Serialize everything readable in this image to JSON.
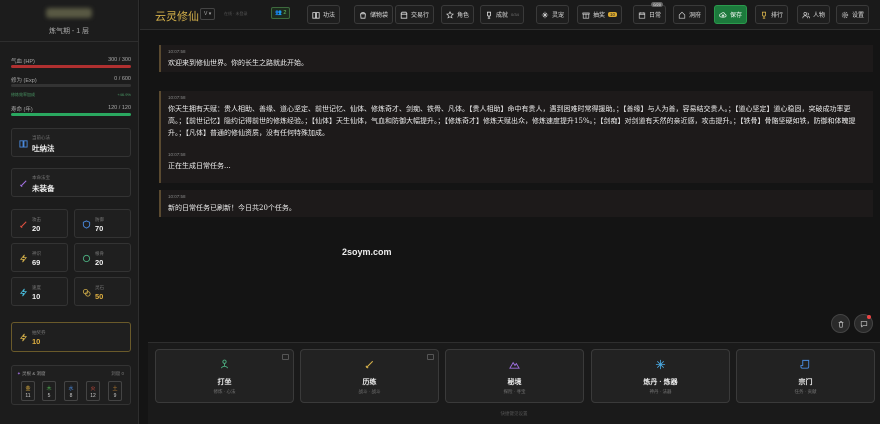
{
  "sidebar": {
    "realm": "炼气期 - 1 层",
    "stats": [
      {
        "label": "气血 (HP)",
        "value": "300 / 300",
        "percent": 100,
        "color": "#b03030"
      },
      {
        "label": "修为 (Exp)",
        "value": "0 / 600",
        "percent": 0,
        "color": "#555555"
      },
      {
        "label": "寿命 (年)",
        "value": "120 / 120",
        "percent": 100,
        "color": "#2aa860"
      }
    ],
    "cultivation_rate": {
      "label": "修炼效率加成",
      "value": "+46.9%"
    },
    "method": {
      "label": "当前心法",
      "value": "吐纳法"
    },
    "weapon": {
      "label": "本命法宝",
      "value": "未装备"
    },
    "attributes": [
      {
        "label": "攻击",
        "value": "20"
      },
      {
        "label": "防御",
        "value": "70"
      },
      {
        "label": "神识",
        "value": "69"
      },
      {
        "label": "根骨",
        "value": "20"
      },
      {
        "label": "速度",
        "value": "10"
      },
      {
        "label": "灵石",
        "value": "50"
      }
    ],
    "lottery": {
      "label": "抽奖券",
      "value": "10"
    },
    "elements": {
      "label": "灵根 & 洞窟",
      "extra": "洞窟 0",
      "items": [
        {
          "name": "金",
          "value": "11",
          "color": "#e0b040"
        },
        {
          "name": "木",
          "value": "5",
          "color": "#4caf50"
        },
        {
          "name": "水",
          "value": "8",
          "color": "#4a8adf"
        },
        {
          "name": "火",
          "value": "12",
          "color": "#e05040"
        },
        {
          "name": "土",
          "value": "9",
          "color": "#c08030"
        }
      ]
    }
  },
  "topbar": {
    "title": "云灵修仙",
    "version": "V",
    "faint_text": "在线 · 未登录",
    "online": "2",
    "buttons": [
      {
        "label": "功法",
        "icon": "book-icon"
      },
      {
        "label": "储物袋",
        "icon": "bag-icon"
      },
      {
        "label": "交易行",
        "icon": "shop-icon"
      },
      {
        "label": "角色",
        "icon": "star-icon"
      },
      {
        "label": "成就",
        "icon": "trophy-icon",
        "count": "0/34"
      },
      {
        "label": "灵宠",
        "icon": "sparkle-icon"
      },
      {
        "label": "抽奖",
        "icon": "gift-icon",
        "badge": "10"
      },
      {
        "label": "日常",
        "icon": "calendar-icon",
        "sup": "0/20"
      },
      {
        "label": "洞府",
        "icon": "home-icon"
      },
      {
        "label": "保存",
        "icon": "cloud-icon"
      },
      {
        "label": "排行",
        "icon": "medal-icon"
      },
      {
        "label": "人物",
        "icon": "users-icon"
      },
      {
        "label": "设置",
        "icon": "gear-icon"
      }
    ]
  },
  "log": [
    {
      "time": "10:07:58",
      "text": "欢迎来到修仙世界。你的长生之路就此开始。"
    },
    {
      "time": "10:07:58",
      "text": "你天生拥有天赋：贵人相助、善缘、道心坚定、前世记忆、仙体、修炼奇才、剑痴、铁骨、凡体。【贵人相助】命中有贵人，遇到困难时常得援助。；【善缘】与人为善，容易结交贵人。；【道心坚定】道心稳固，突破成功率更高。；【前世记忆】隐约记得前世的修炼经验。；【仙体】天生仙体，气血和防御大幅提升。；【修炼奇才】修炼天赋出众，修炼速度提升15%。；【剑痴】对剑道有天然的亲近感，攻击提升。；【铁骨】骨骼坚硬如铁，防御和体魄提升。；【凡体】普通的修仙资质，没有任何特殊加成。"
    },
    {
      "time": "10:07:58",
      "text": "正在生成日常任务..."
    },
    {
      "time": "10:07:58",
      "text": "新的日常任务已刷新！今日共20个任务。"
    }
  ],
  "watermark": "2soym.com",
  "actions": [
    {
      "label": "打坐",
      "sub": "修炼 · 心法",
      "icon": "meditate-icon",
      "color": "#4caf80"
    },
    {
      "label": "历练",
      "sub": "战斗 · 战斗",
      "icon": "sword-icon",
      "color": "#d4b04a"
    },
    {
      "label": "秘境",
      "sub": "探险 · 寻宝",
      "icon": "mountain-icon",
      "color": "#a070e0"
    },
    {
      "label": "炼丹 · 炼器",
      "sub": "神丹 · 法器",
      "icon": "sparkle-icon",
      "color": "#4aa8e0"
    },
    {
      "label": "宗门",
      "sub": "任务 · 贡献",
      "icon": "scroll-icon",
      "color": "#4a8adf"
    }
  ],
  "bottom_hint": "快捷键见设置"
}
